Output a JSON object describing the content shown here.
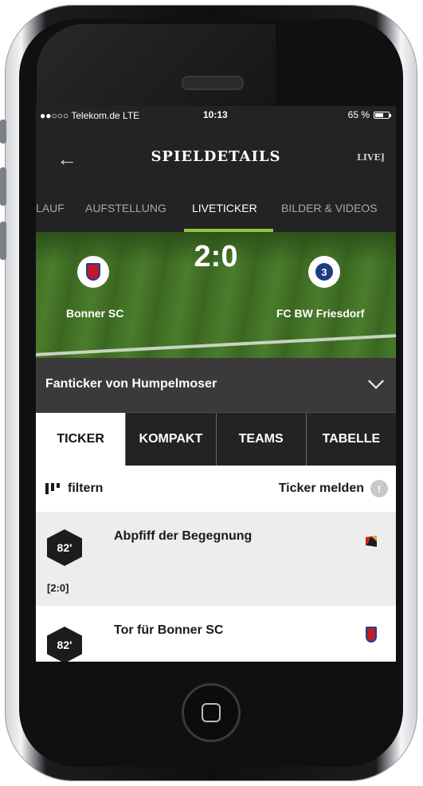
{
  "status": {
    "carrier": "●●○○○ Telekom.de LTE",
    "time": "10:13",
    "battery": "65 %",
    "battery_level": 0.65
  },
  "header": {
    "title": "SPIELDETAILS",
    "live_label": "LIVE"
  },
  "tabs": [
    {
      "label": "LAUF",
      "active": false
    },
    {
      "label": "AUFSTELLUNG",
      "active": false
    },
    {
      "label": "LIVETICKER",
      "active": true
    },
    {
      "label": "BILDER & VIDEOS",
      "active": false
    }
  ],
  "match": {
    "home": "Bonner SC",
    "away": "FC BW Friesdorf",
    "score": "2:0"
  },
  "fanticker": {
    "label": "Fanticker von Humpelmoser"
  },
  "segments": [
    {
      "label": "TICKER",
      "active": true
    },
    {
      "label": "KOMPAKT",
      "active": false
    },
    {
      "label": "TEAMS",
      "active": false
    },
    {
      "label": "TABELLE",
      "active": false
    }
  ],
  "filter": {
    "label": "filtern",
    "report_label": "Ticker melden"
  },
  "ticker": [
    {
      "minute": "82'",
      "title": "Abpfiff der Begegnung",
      "score": "[2:0]",
      "icon": "whistle-icon"
    },
    {
      "minute": "82'",
      "title": "Tor für Bonner SC",
      "icon": "bonner-sc-crest-icon"
    }
  ],
  "colors": {
    "accent": "#8cc63f",
    "dark": "#232323",
    "bar": "#3a3a3a"
  }
}
